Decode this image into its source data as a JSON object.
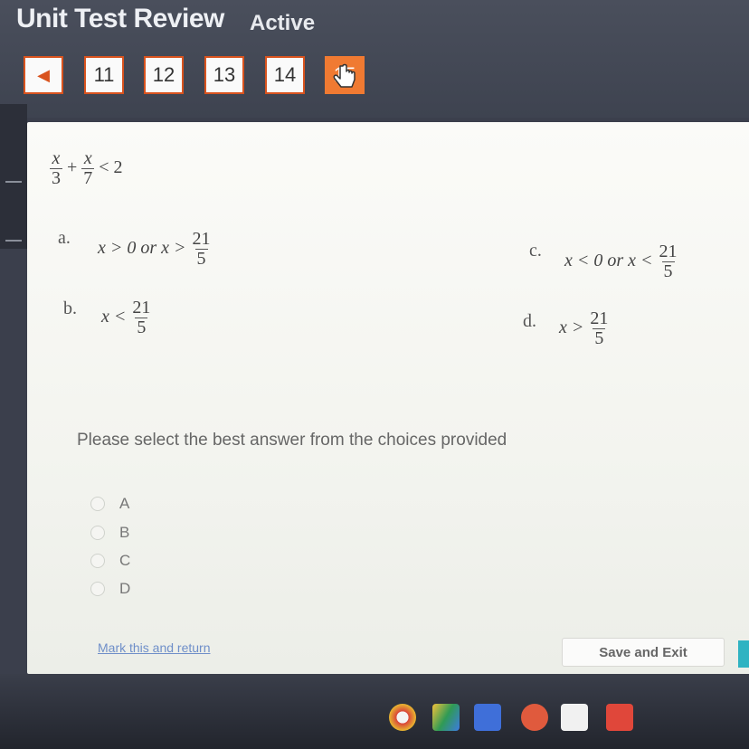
{
  "header": {
    "title": "Unit Test Review",
    "status": "Active"
  },
  "nav": {
    "back_glyph": "◀",
    "pages": [
      "11",
      "12",
      "13",
      "14",
      "15"
    ],
    "active_index": 4
  },
  "question": {
    "expression": {
      "term1_num": "x",
      "term1_den": "3",
      "op": "+",
      "term2_num": "x",
      "term2_den": "7",
      "rel": "< 2"
    },
    "options": {
      "a": {
        "label": "a.",
        "lhs": "x > 0 or x >",
        "num": "21",
        "den": "5"
      },
      "b": {
        "label": "b.",
        "lhs": "x <",
        "num": "21",
        "den": "5"
      },
      "c": {
        "label": "c.",
        "lhs": "x < 0 or x <",
        "num": "21",
        "den": "5"
      },
      "d": {
        "label": "d.",
        "lhs": "x >",
        "num": "21",
        "den": "5"
      }
    }
  },
  "prompt": "Please select the best answer from the choices provided",
  "choices": [
    "A",
    "B",
    "C",
    "D"
  ],
  "footer": {
    "mark_link": "Mark this and return",
    "save_label": "Save and Exit"
  },
  "colors": {
    "accent": "#d9531e",
    "active_page": "#f07a32",
    "link": "#6f8fc9",
    "next_edge": "#2fb3c2"
  },
  "icons": {
    "back": "left-arrow-icon",
    "cursor": "hand-pointer-icon"
  }
}
